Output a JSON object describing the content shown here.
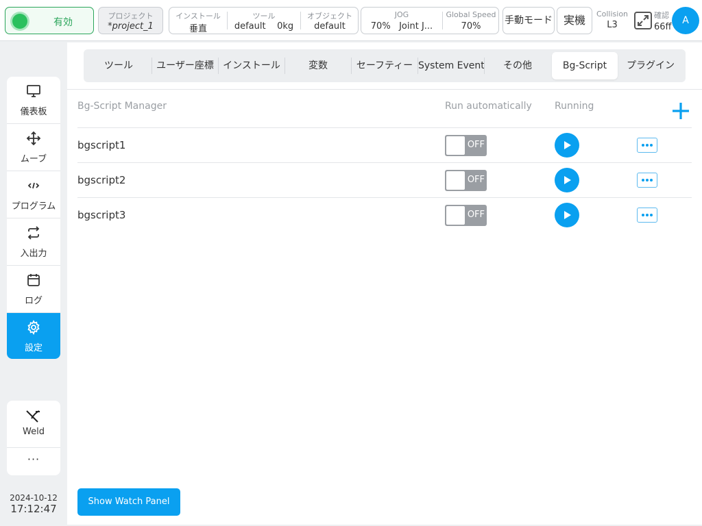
{
  "topbar": {
    "enable_label": "有効",
    "project": {
      "caption": "プロジェクト",
      "value": "*project_1"
    },
    "install": {
      "caption": "インストール",
      "value": "垂直"
    },
    "tool": {
      "caption": "ツール",
      "value": "default",
      "weight": "0kg"
    },
    "object": {
      "caption": "オブジェクト",
      "value": "default"
    },
    "jog": {
      "caption": "JOG",
      "value": "70%",
      "mode": "Joint J..."
    },
    "global_speed": {
      "caption": "Global Speed",
      "value": "70%"
    },
    "manual_mode": "手動モード",
    "real_machine": "実機",
    "collision": {
      "caption": "Collision",
      "value": "L3"
    },
    "confirm": {
      "caption": "確認",
      "value": "66ff"
    },
    "avatar": "A"
  },
  "sidebar": {
    "items": [
      {
        "label": "儀表板",
        "icon": "monitor-icon"
      },
      {
        "label": "ムーブ",
        "icon": "move-icon"
      },
      {
        "label": "プログラム",
        "icon": "code-icon"
      },
      {
        "label": "入出力",
        "icon": "io-icon"
      },
      {
        "label": "ログ",
        "icon": "calendar-icon"
      },
      {
        "label": "設定",
        "icon": "gear-icon",
        "active": true
      }
    ],
    "weld": "Weld",
    "more": "···"
  },
  "clock": {
    "date": "2024-10-12",
    "time": "17:12:47"
  },
  "tabs": [
    "ツール",
    "ユーザー座標",
    "インストール",
    "変数",
    "セーフティー",
    "System Event",
    "その他",
    "Bg-Script",
    "プラグイン"
  ],
  "active_tab": "Bg-Script",
  "manager": {
    "header_name": "Bg-Script Manager",
    "header_auto": "Run automatically",
    "header_running": "Running",
    "scripts": [
      {
        "name": "bgscript1",
        "auto": "OFF"
      },
      {
        "name": "bgscript2",
        "auto": "OFF"
      },
      {
        "name": "bgscript3",
        "auto": "OFF"
      }
    ]
  },
  "watch_button": "Show Watch Panel",
  "colors": {
    "accent": "#0aa0f0",
    "enabled": "#2bc05e",
    "toggle_off": "#9a9ea3"
  }
}
